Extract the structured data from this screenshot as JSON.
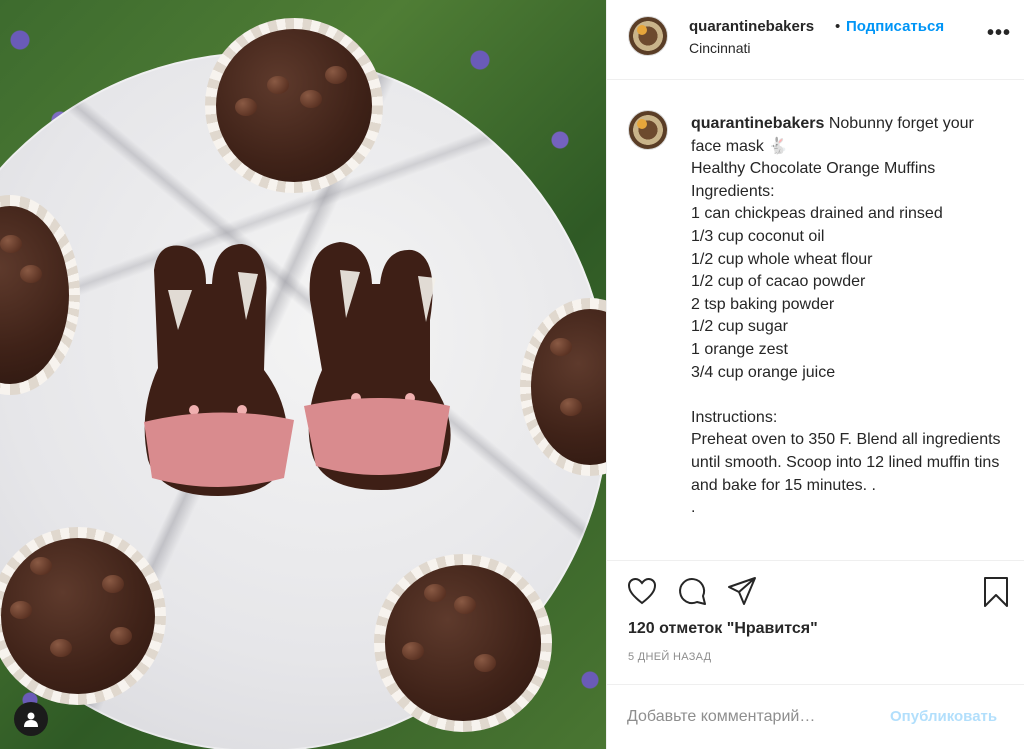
{
  "post": {
    "username": "quarantinebakers",
    "follow_label": "Подписаться",
    "location": "Cincinnati",
    "more_label": "•••"
  },
  "caption": {
    "username": "quarantinebakers",
    "text": " Nobunny forget your face mask 🐇\nHealthy Chocolate Orange Muffins\nIngredients:\n1 can chickpeas drained and rinsed\n1/3 cup coconut oil\n1/2 cup whole wheat flour\n1/2 cup of cacao powder\n2 tsp baking powder\n1/2 cup sugar\n1 orange zest\n3/4 cup orange juice\n\nInstructions:\nPreheat oven to 350 F. Blend all ingredients until smooth. Scoop into 12 lined muffin tins and bake for 15 minutes. .\n."
  },
  "actions": {
    "icons": [
      "heart-icon",
      "comment-icon",
      "share-icon",
      "bookmark-icon"
    ],
    "likes_text": "120 отметок \"Нравится\"",
    "date_text": "5 ДНЕЙ НАЗАД"
  },
  "comment": {
    "placeholder": "Добавьте комментарий…",
    "publish_label": "Опубликовать"
  },
  "colors": {
    "link_blue": "#0095f6",
    "publish_disabled": "#b2dffc",
    "muted_text": "#8e8e8e",
    "text": "#262626"
  }
}
